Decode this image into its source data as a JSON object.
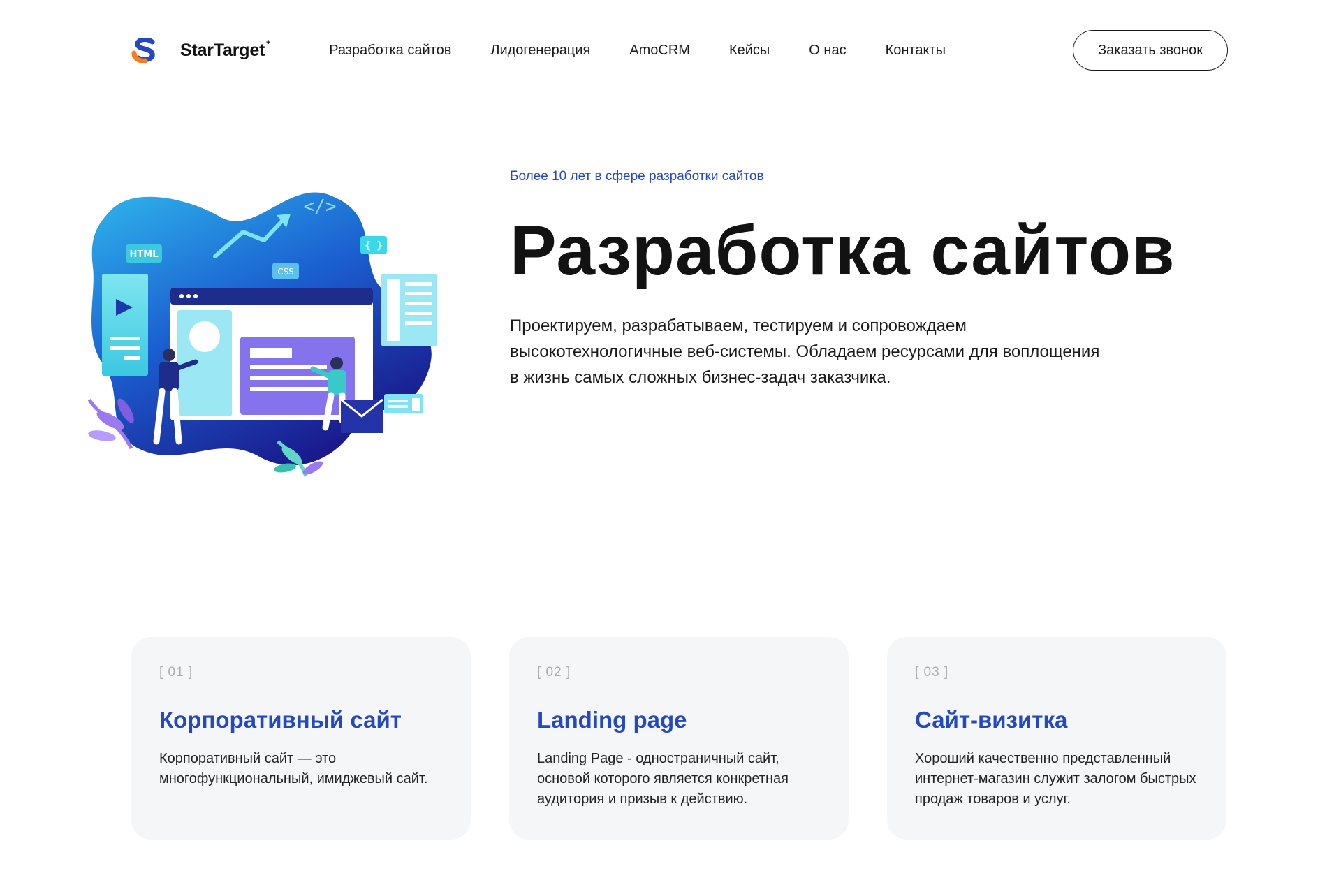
{
  "header": {
    "logo_text": "StarTarget",
    "logo_sup": "+",
    "nav": [
      "Разработка сайтов",
      "Лидогенерация",
      "AmoCRM",
      "Кейсы",
      "О нас",
      "Контакты"
    ],
    "cta_label": "Заказать звонок"
  },
  "hero": {
    "eyebrow": "Более 10 лет в сфере разработки сайтов",
    "title": "Разработка сайтов",
    "description": "Проектируем, разрабатываем, тестируем и сопровождаем высокотехнологичные веб-системы. Обладаем ресурсами для воплощения в жизнь самых сложных бизнес-задач заказчика.",
    "illustration": {
      "html_tag": "HTML",
      "css_tag": "CSS",
      "braces_tag": "{ }",
      "code_tag": "</>"
    }
  },
  "cards": [
    {
      "index": "[ 01 ]",
      "title": "Корпоративный сайт",
      "description": "Корпоративный сайт — это многофункциональный, имиджевый сайт."
    },
    {
      "index": "[ 02 ]",
      "title": "Landing page",
      "description": "Landing Page - одностраничный сайт, основой которого является конкретная аудитория и призыв к действию."
    },
    {
      "index": "[ 03 ]",
      "title": "Сайт-визитка",
      "description": "Хороший качественно представленный интернет-магазин служит залогом быстрых продаж товаров и услуг."
    }
  ],
  "colors": {
    "accent": "#2448c2",
    "logo_orange": "#ff7a1a",
    "logo_blue": "#2448c2",
    "card_bg": "#f5f6f8"
  }
}
